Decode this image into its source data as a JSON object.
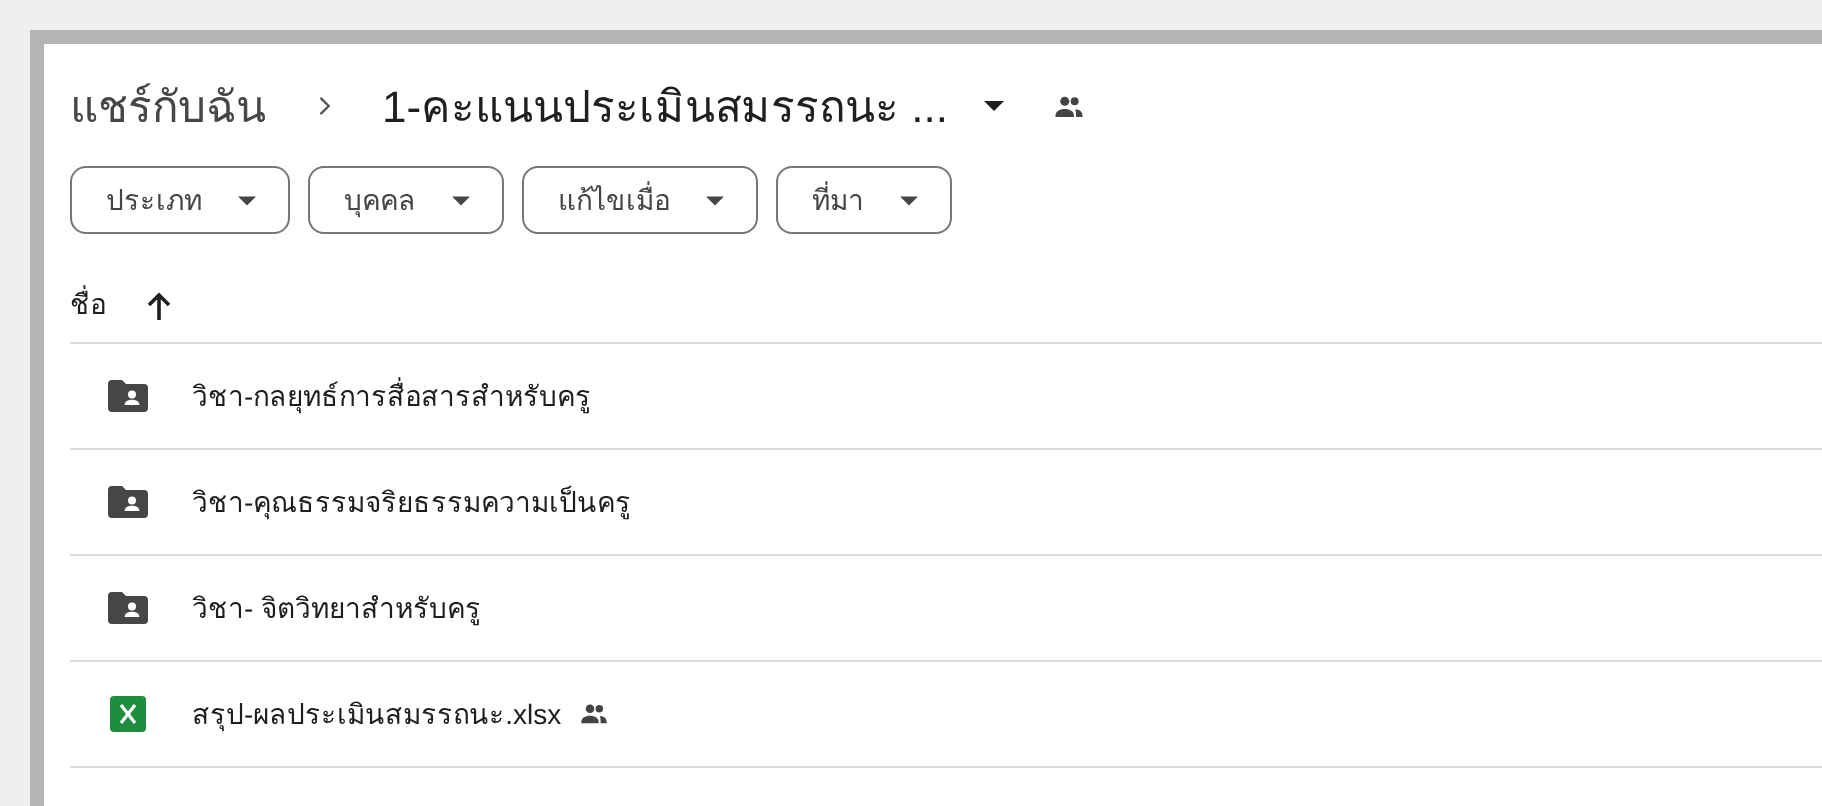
{
  "breadcrumb": [
    {
      "label": "แชร์กับฉัน",
      "current": false
    },
    {
      "label": "1-คะแนนประเมินสมรรถนะ ...",
      "current": true
    }
  ],
  "filters": [
    {
      "label": "ประเภท"
    },
    {
      "label": "บุคคล"
    },
    {
      "label": "แก้ไขเมื่อ"
    },
    {
      "label": "ที่มา"
    }
  ],
  "list_header": {
    "label": "ชื่อ",
    "sort_ascending": true
  },
  "files": [
    {
      "kind": "shared_folder",
      "name": "วิชา-กลยุทธ์การสื่อสารสำหรับครู",
      "shared": false
    },
    {
      "kind": "shared_folder",
      "name": "วิชา-คุณธรรมจริยธรรมความเป็นครู",
      "shared": false
    },
    {
      "kind": "shared_folder",
      "name": "วิชา- จิตวิทยาสำหรับครู",
      "shared": false
    },
    {
      "kind": "spreadsheet",
      "name": "สรุป-ผลประเมินสมรรถนะ.xlsx",
      "shared": true
    }
  ]
}
